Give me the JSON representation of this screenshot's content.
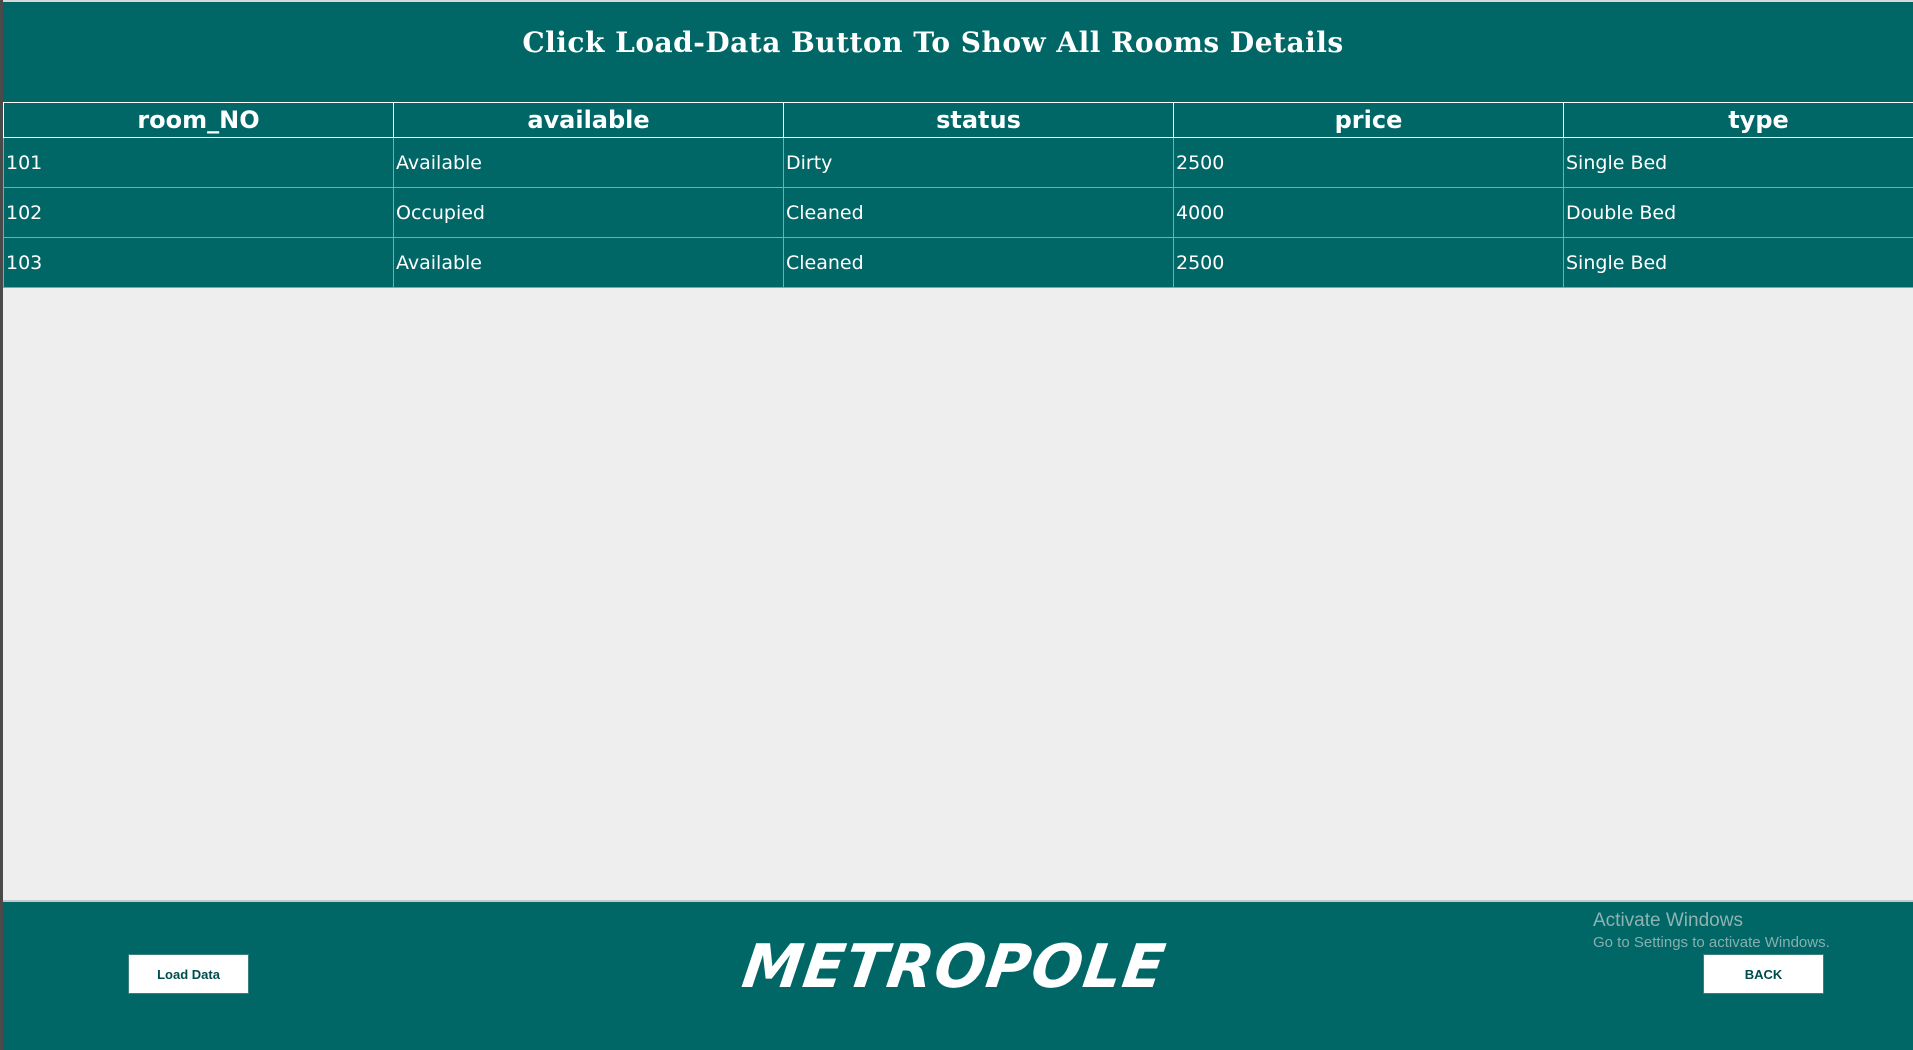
{
  "header": {
    "title": "Click Load-Data Button To Show All Rooms Details"
  },
  "table": {
    "columns": [
      "room_NO",
      "available",
      "status",
      "price",
      "type"
    ],
    "rows": [
      [
        "101",
        "Available",
        "Dirty",
        "2500",
        "Single Bed"
      ],
      [
        "102",
        "Occupied",
        "Cleaned",
        "4000",
        "Double Bed"
      ],
      [
        "103",
        "Available",
        "Cleaned",
        "2500",
        "Single Bed"
      ]
    ]
  },
  "footer": {
    "load_label": "Load Data",
    "brand": "METROPOLE",
    "back_label": "BACK"
  },
  "watermark": {
    "title": "Activate Windows",
    "subtitle": "Go to Settings to activate Windows."
  },
  "colors": {
    "primary": "#006666",
    "background": "#eeeeee",
    "text": "#ffffff"
  }
}
